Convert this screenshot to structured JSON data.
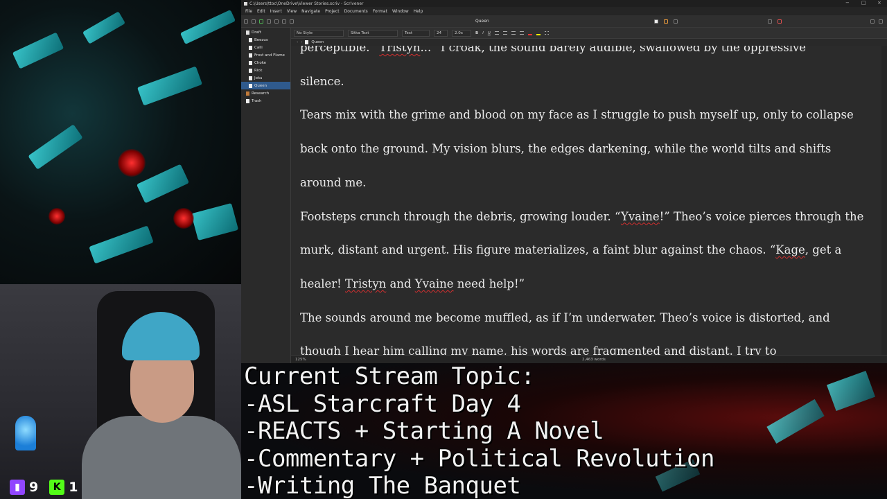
{
  "window": {
    "title": "C:\\Users\\ttoc\\OneDrive\\Viewer Stories.scriv - Scrivener",
    "minimize_glyph": "−",
    "maximize_glyph": "□",
    "close_glyph": "×"
  },
  "menu": [
    "File",
    "Edit",
    "Insert",
    "View",
    "Navigate",
    "Project",
    "Documents",
    "Format",
    "Window",
    "Help"
  ],
  "toolbar": {
    "document_title": "Queen"
  },
  "binder": {
    "items": [
      {
        "label": "Draft",
        "kind": "folder",
        "level": 0,
        "selected": false
      },
      {
        "label": "Beezus",
        "kind": "doc",
        "level": 1,
        "selected": false
      },
      {
        "label": "Calli",
        "kind": "doc",
        "level": 1,
        "selected": false
      },
      {
        "label": "Frost and Flame",
        "kind": "doc",
        "level": 1,
        "selected": false
      },
      {
        "label": "Choke",
        "kind": "doc",
        "level": 1,
        "selected": false
      },
      {
        "label": "Rick",
        "kind": "doc",
        "level": 1,
        "selected": false
      },
      {
        "label": "Joku",
        "kind": "doc",
        "level": 1,
        "selected": false
      },
      {
        "label": "Queen",
        "kind": "doc",
        "level": 1,
        "selected": true
      },
      {
        "label": "Research",
        "kind": "research",
        "level": 0,
        "selected": false
      },
      {
        "label": "Trash",
        "kind": "trash",
        "level": 0,
        "selected": false
      }
    ]
  },
  "format_bar": {
    "style": "No Style",
    "font": "Sitka Text",
    "typeface": "Text",
    "size": "24",
    "line_spacing": "2.0x",
    "bold": "B",
    "italic": "I",
    "underline": "U"
  },
  "doc_header": {
    "title": "Queen"
  },
  "editor": {
    "paragraphs": [
      [
        {
          "t": "perceptible. “"
        },
        {
          "t": "Tristyn",
          "spell": true
        },
        {
          "t": "...” I croak, the sound barely audible, swallowed by the oppressive"
        }
      ],
      [
        {
          "t": "silence."
        }
      ],
      [
        {
          "t": "   Tears mix with the grime and blood on my face as I struggle to push myself up, only to collapse back onto the ground. My vision blurs, the edges darkening, while the world tilts and shifts around me."
        }
      ],
      [
        {
          "t": "   Footsteps crunch through the debris, growing louder. “"
        },
        {
          "t": "Yvaine",
          "spell": true
        },
        {
          "t": "!” Theo’s voice pierces through the murk, distant and urgent. His figure materializes, a faint blur against the chaos. “"
        },
        {
          "t": "Kage",
          "spell": true
        },
        {
          "t": ", get a healer! "
        },
        {
          "t": "Tristyn",
          "spell": true
        },
        {
          "t": " and "
        },
        {
          "t": "Yvaine",
          "spell": true
        },
        {
          "t": " need help!”"
        }
      ],
      [
        {
          "t": "   The sounds around me become muffled, as if I’m underwater. Theo’s voice is distorted, and though I hear him calling my name, his words are fragmented and distant. I try to"
        }
      ]
    ]
  },
  "status_bar": {
    "zoom": "125%",
    "word_count": "2,463 words"
  },
  "overlay": {
    "lines": [
      "Current Stream Topic:",
      "-ASL Starcraft Day 4",
      "-REACTS + Starting A Novel",
      "-Commentary + Political Revolution",
      "-Writing The Banquet"
    ]
  },
  "stream_stats": {
    "twitch_viewers": "9",
    "kick_viewers": "1",
    "twitch_glyph": "▮",
    "kick_glyph": "K"
  },
  "colors": {
    "accent_selected": "#2f5a8d",
    "twitch": "#9146ff",
    "kick": "#53fc18",
    "spell_error": "#d32f2f"
  }
}
